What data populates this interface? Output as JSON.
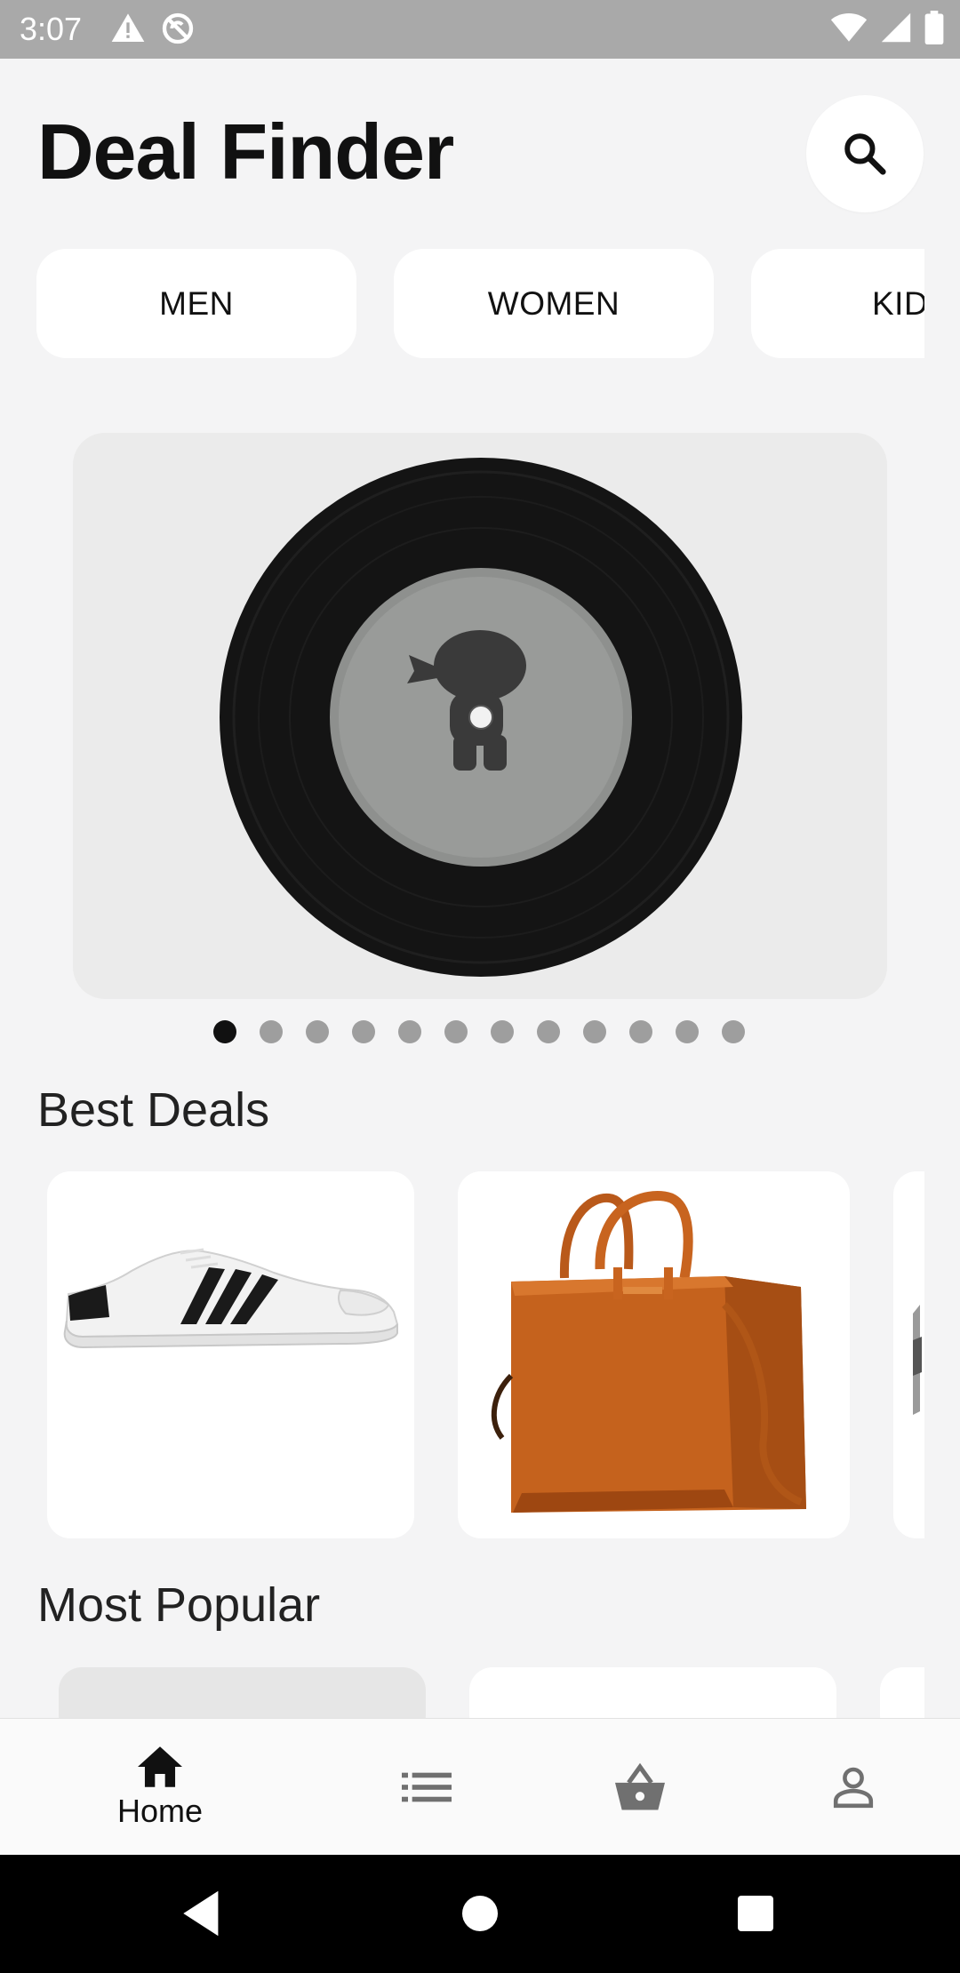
{
  "status_bar": {
    "time": "3:07",
    "left_icons": [
      "warning-icon",
      "sync-disabled-icon"
    ],
    "right_icons": [
      "wifi-icon",
      "signal-icon",
      "battery-icon"
    ]
  },
  "header": {
    "title": "Deal Finder",
    "search_icon": "search-icon"
  },
  "categories": [
    {
      "label": "MEN"
    },
    {
      "label": "WOMEN"
    },
    {
      "label": "KID"
    }
  ],
  "carousel": {
    "image": "vinyl-record-image",
    "page_count": 12,
    "active_page": 1
  },
  "sections": {
    "best_deals": "Best Deals",
    "most_popular": "Most Popular"
  },
  "best_deals": [
    {
      "image": "sneaker-image"
    },
    {
      "image": "handbag-image"
    },
    {
      "image": "partial-product-image"
    }
  ],
  "bottom_nav": {
    "items": [
      {
        "icon": "home-icon",
        "label": "Home",
        "active": true
      },
      {
        "icon": "list-icon"
      },
      {
        "icon": "basket-icon"
      },
      {
        "icon": "profile-icon"
      }
    ]
  },
  "colors": {
    "background": "#f4f4f5",
    "card": "#ffffff",
    "accent": "#111111",
    "inactive": "#9e9e9e"
  }
}
